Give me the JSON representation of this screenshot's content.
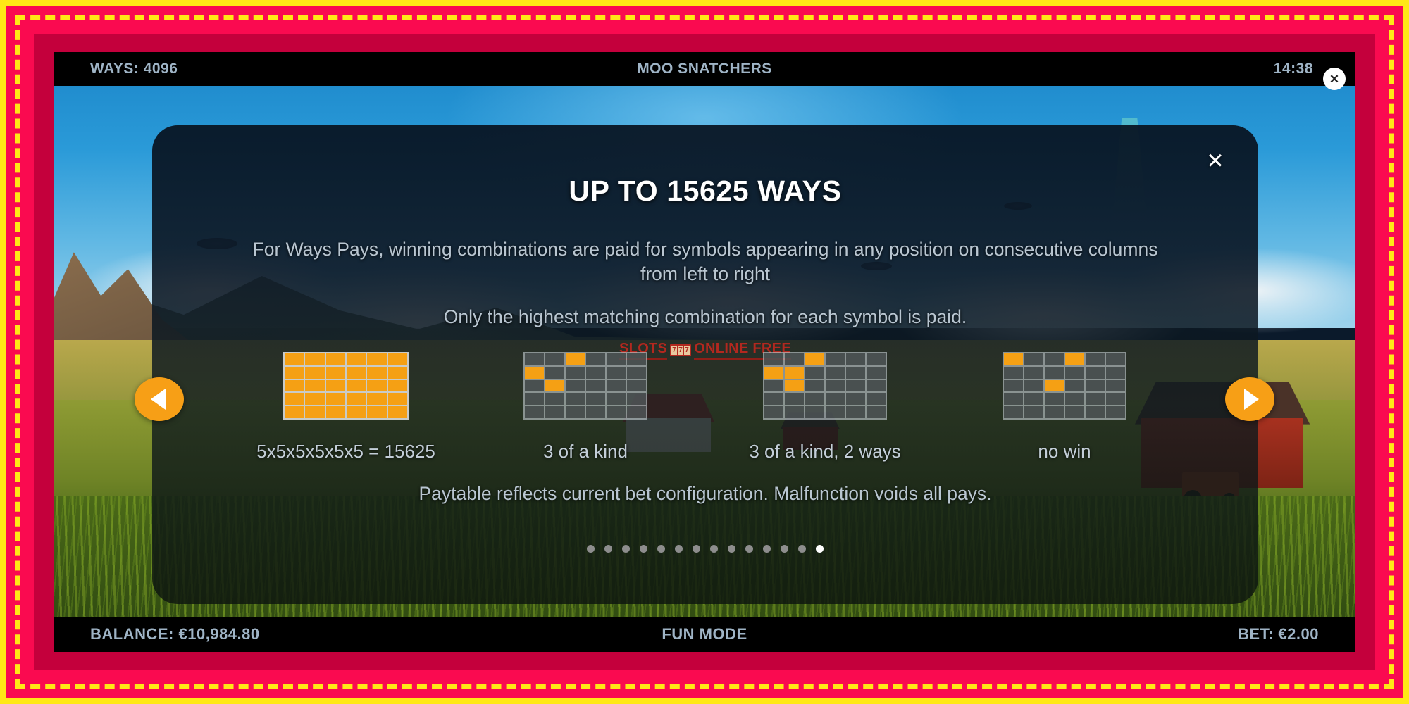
{
  "topbar": {
    "ways_label": "WAYS: 4096",
    "game_title": "MOO SNATCHERS",
    "clock": "14:38",
    "window_close_icon": "close-icon"
  },
  "bottombar": {
    "balance": "BALANCE: €10,984.80",
    "mode": "FUN MODE",
    "bet": "BET: €2.00"
  },
  "modal": {
    "title": "UP TO 15625 WAYS",
    "close_icon": "×",
    "paragraph1": "For Ways Pays, winning combinations are paid for symbols appearing in any position on consecutive columns from left to right",
    "paragraph2": "Only the highest matching combination for each symbol is paid.",
    "footnote": "Paytable reflects current bet configuration. Malfunction voids all pays.",
    "watermark": {
      "left_text": "SLOTS",
      "reels": [
        "7",
        "7",
        "7"
      ],
      "right_text": "ONLINE FREE",
      "color": "#b3281f"
    },
    "demos": [
      {
        "name": "full-grid",
        "label": "5x5x5x5x5x5 = 15625",
        "cols": 6,
        "rows": 5,
        "all_filled": true,
        "filled": []
      },
      {
        "name": "three-of-a-kind",
        "label": "3 of a kind",
        "cols": 6,
        "rows": 5,
        "all_filled": false,
        "filled": [
          [
            0,
            2
          ],
          [
            1,
            0
          ],
          [
            2,
            1
          ]
        ]
      },
      {
        "name": "three-of-a-kind-two-ways",
        "label": "3 of a kind, 2 ways",
        "cols": 6,
        "rows": 5,
        "all_filled": false,
        "filled": [
          [
            0,
            2
          ],
          [
            1,
            0
          ],
          [
            1,
            1
          ],
          [
            2,
            1
          ]
        ]
      },
      {
        "name": "no-win",
        "label": "no win",
        "cols": 6,
        "rows": 5,
        "all_filled": false,
        "filled": [
          [
            0,
            0
          ],
          [
            0,
            3
          ],
          [
            2,
            2
          ]
        ]
      }
    ],
    "pagination": {
      "total": 14,
      "active_index": 13
    }
  },
  "nav": {
    "prev_icon": "chevron-left-icon",
    "next_icon": "chevron-right-icon",
    "accent_color": "#f79f16"
  }
}
